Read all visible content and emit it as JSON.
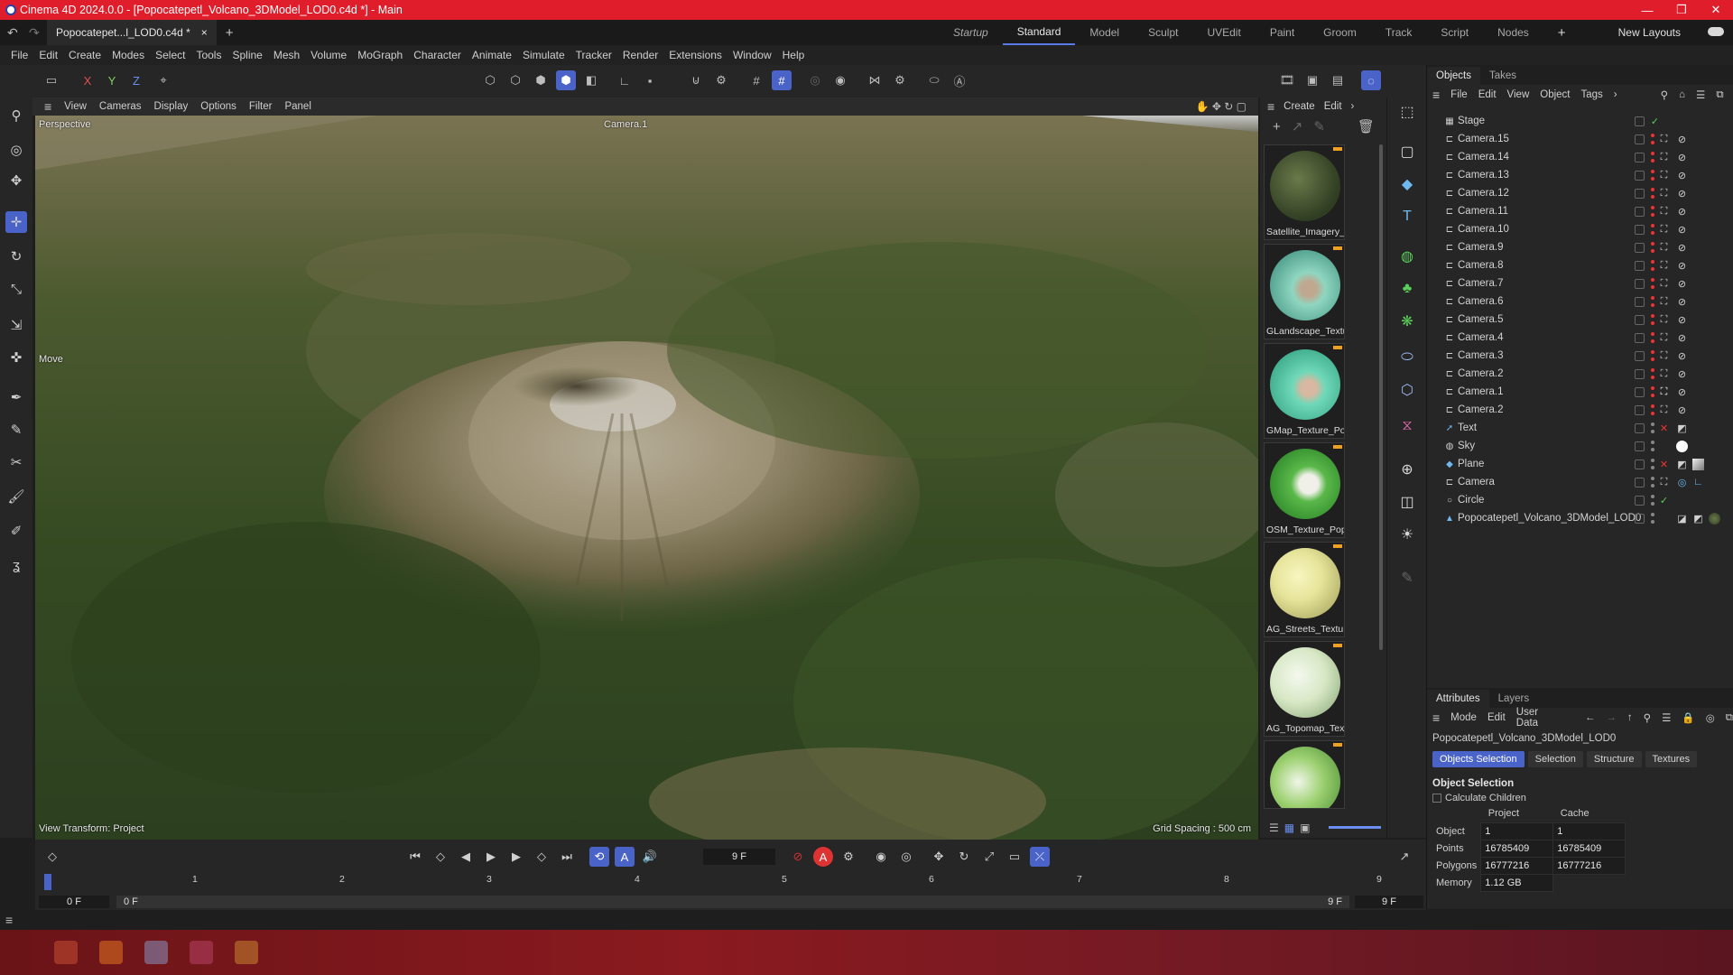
{
  "window": {
    "title": "Cinema 4D 2024.0.0 - [Popocatepetl_Volcano_3DModel_LOD0.c4d *] - Main"
  },
  "tabs": {
    "doc": "Popocatepet...l_LOD0.c4d *",
    "close": "×",
    "add": "+"
  },
  "layouts": {
    "items": [
      "Startup",
      "Standard",
      "Model",
      "Sculpt",
      "UVEdit",
      "Paint",
      "Groom",
      "Track",
      "Script",
      "Nodes"
    ],
    "new_layouts": "New Layouts",
    "add": "+"
  },
  "menu": [
    "File",
    "Edit",
    "Create",
    "Modes",
    "Select",
    "Tools",
    "Spline",
    "Mesh",
    "Volume",
    "MoGraph",
    "Character",
    "Animate",
    "Simulate",
    "Tracker",
    "Render",
    "Extensions",
    "Window",
    "Help"
  ],
  "axis": {
    "x": "X",
    "y": "Y",
    "z": "Z"
  },
  "viewport": {
    "menu": [
      "View",
      "Cameras",
      "Display",
      "Options",
      "Filter",
      "Panel"
    ],
    "perspective": "Perspective",
    "camera": "Camera.1",
    "move": "Move",
    "view_transform": "View Transform: Project",
    "grid_spacing": "Grid Spacing : 500 cm"
  },
  "materials": {
    "menu": [
      "Create",
      "Edit"
    ],
    "items": [
      {
        "name": "Satellite_Imagery_",
        "color": "#2f3d22"
      },
      {
        "name": "GLandscape_Textu",
        "color": "#8fd6c0"
      },
      {
        "name": "GMap_Texture_Po",
        "color": "#6fd8b8"
      },
      {
        "name": "OSM_Texture_Pop",
        "color": "#5ab84a"
      },
      {
        "name": "AG_Streets_Textur",
        "color": "#e6e49a"
      },
      {
        "name": "AG_Topomap_Text",
        "color": "#d8e8c6"
      },
      {
        "name": "",
        "color": "#9cd070"
      }
    ]
  },
  "objects_panel": {
    "tabs": [
      "Objects",
      "Takes"
    ],
    "menu": [
      "File",
      "Edit",
      "View",
      "Object",
      "Tags"
    ],
    "items": [
      "Stage",
      "Camera.15",
      "Camera.14",
      "Camera.13",
      "Camera.12",
      "Camera.11",
      "Camera.10",
      "Camera.9",
      "Camera.8",
      "Camera.7",
      "Camera.6",
      "Camera.5",
      "Camera.4",
      "Camera.3",
      "Camera.2",
      "Camera.1",
      "Camera.2",
      "Text",
      "Sky",
      "Plane",
      "Camera",
      "Circle",
      "Popocatepetl_Volcano_3DModel_LOD0"
    ]
  },
  "attributes": {
    "tabs": [
      "Attributes",
      "Layers"
    ],
    "menu": [
      "Mode",
      "Edit",
      "User Data"
    ],
    "object_name": "Popocatepetl_Volcano_3DModel_LOD0",
    "subtabs": [
      "Objects Selection",
      "Selection",
      "Structure",
      "Textures"
    ],
    "section": "Object Selection",
    "calc_children": "Calculate Children",
    "col_project": "Project",
    "col_cache": "Cache",
    "rows": [
      {
        "label": "Object",
        "project": "1",
        "cache": "1"
      },
      {
        "label": "Points",
        "project": "16785409",
        "cache": "16785409"
      },
      {
        "label": "Polygons",
        "project": "16777216",
        "cache": "16777216"
      },
      {
        "label": "Memory",
        "project": "1.12 GB",
        "cache": ""
      }
    ]
  },
  "timeline": {
    "current_frame": "9 F",
    "ticks": [
      "0",
      "1",
      "2",
      "3",
      "4",
      "5",
      "6",
      "7",
      "8",
      "9"
    ],
    "start": "0 F",
    "range_start": "0 F",
    "range_end": "9 F",
    "end": "9 F"
  },
  "colors": {
    "accent": "#4a63c9",
    "titlebar": "#e01e2b"
  }
}
